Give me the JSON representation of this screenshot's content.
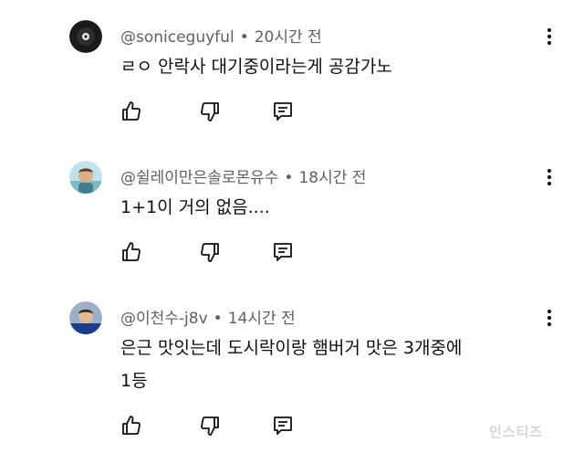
{
  "comments": [
    {
      "author": "@soniceguyful",
      "separator": "•",
      "time": "20시간 전",
      "lines": [
        "ㄹㅇ 안락사 대기중이라는게 공감가노"
      ]
    },
    {
      "author": "@쉴레이만은솔로몬유수",
      "separator": "•",
      "time": "18시간 전",
      "lines": [
        "1+1이 거의 없음...."
      ]
    },
    {
      "author": "@이천수-j8v",
      "separator": "•",
      "time": "14시간 전",
      "lines": [
        "은근 맛잇는데 도시락이랑 햄버거 맛은 3개중에",
        "1등"
      ]
    }
  ],
  "icons": {
    "like": "thumbs-up-icon",
    "dislike": "thumbs-down-icon",
    "reply": "reply-icon",
    "menu": "more-vert-icon"
  },
  "colors": {
    "text": "#0f0f0f",
    "meta": "#606060",
    "icon": "#0f0f0f"
  },
  "watermark": "인스티즈"
}
